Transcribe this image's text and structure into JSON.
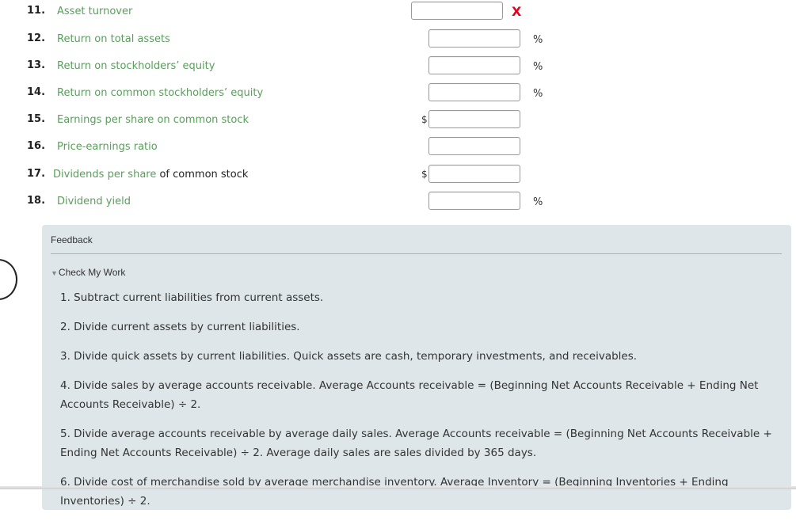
{
  "questions": [
    {
      "num": "11.",
      "label": "Asset turnover",
      "plain": "",
      "input_value": "",
      "prefix": "",
      "suffix": "",
      "error": "X"
    },
    {
      "num": "12.",
      "label": "Return on total assets",
      "plain": "",
      "input_value": "",
      "prefix": "",
      "suffix": "%",
      "error": ""
    },
    {
      "num": "13.",
      "label": "Return on stockholders’ equity",
      "plain": "",
      "input_value": "",
      "prefix": "",
      "suffix": "%",
      "error": ""
    },
    {
      "num": "14.",
      "label": "Return on common stockholders’ equity",
      "plain": "",
      "input_value": "",
      "prefix": "",
      "suffix": "%",
      "error": ""
    },
    {
      "num": "15.",
      "label": "Earnings per share on common stock",
      "plain": "",
      "input_value": "",
      "prefix": "$",
      "suffix": "",
      "error": ""
    },
    {
      "num": "16.",
      "label": "Price-earnings ratio",
      "plain": "",
      "input_value": "",
      "prefix": "",
      "suffix": "",
      "error": ""
    },
    {
      "num": "17.",
      "label": "Dividends per share",
      "plain": " of common stock",
      "input_value": "",
      "prefix": "$",
      "suffix": "",
      "error": ""
    },
    {
      "num": "18.",
      "label": "Dividend yield",
      "plain": "",
      "input_value": "",
      "prefix": "",
      "suffix": "%",
      "error": ""
    }
  ],
  "feedback": {
    "title": "Feedback",
    "toggle_label": "Check My Work",
    "items": [
      "1. Subtract current liabilities from current assets.",
      "2. Divide current assets by current liabilities.",
      "3. Divide quick assets by current liabilities. Quick assets are cash, temporary investments, and receivables.",
      "4. Divide sales by average accounts receivable. Average Accounts receivable = (Beginning Net Accounts Receivable + Ending Net Accounts Receivable) ÷ 2.",
      "5. Divide average accounts receivable by average daily sales. Average Accounts receivable = (Beginning Net Accounts Receivable + Ending Net Accounts Receivable) ÷ 2. Average daily sales are sales divided by 365 days.",
      "6. Divide cost of merchandise sold by average merchandise inventory. Average Inventory = (Beginning Inventories + Ending Inventories) ÷ 2."
    ]
  }
}
